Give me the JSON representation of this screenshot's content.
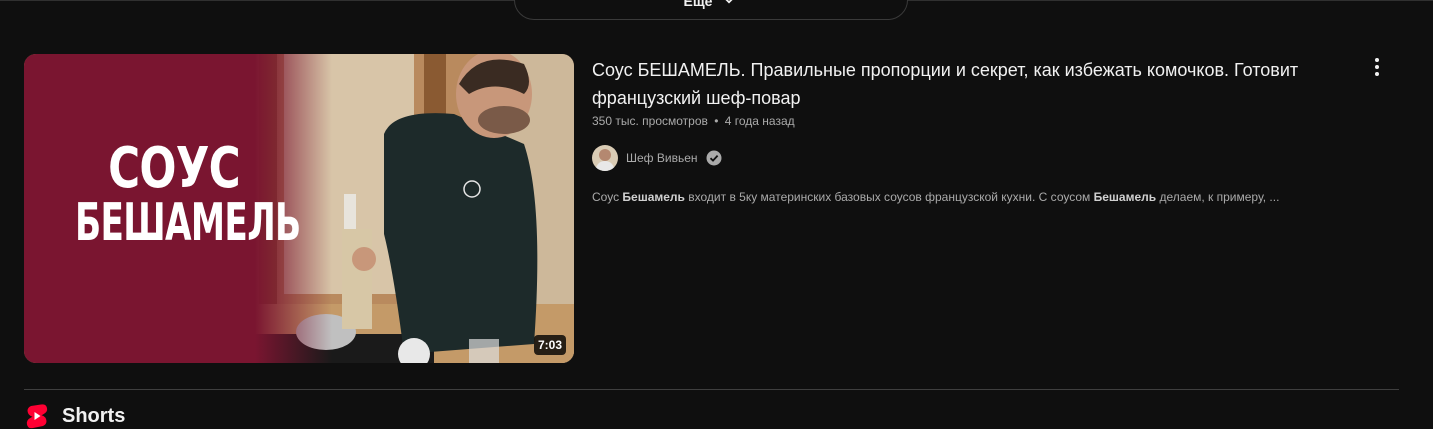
{
  "more_button": {
    "label": "Еще",
    "icon": "chevron-down-icon"
  },
  "video": {
    "thumbnail_text": {
      "line1": "СОУС",
      "line2": "БЕШАМЕЛЬ"
    },
    "duration": "7:03",
    "title": "Соус БЕШАМЕЛЬ. Правильные пропорции и секрет, как избежать комочков. Готовит французский шеф-повар",
    "views": "350 тыс. просмотров",
    "separator": "•",
    "age": "4 года назад",
    "channel": {
      "name": "Шеф Вивьен",
      "verified": true,
      "icon": "verified-check-icon"
    },
    "description": {
      "p1": "Соус ",
      "b1": "Бешамель",
      "p2": " входит в 5ку материнских базовых соусов французской кухни. С соусом ",
      "b2": "Бешамель",
      "p3": " делаем, к примеру, ..."
    },
    "menu_icon": "more-vert-icon"
  },
  "shelf": {
    "title": "Shorts",
    "icon": "shorts-logo-icon"
  },
  "colors": {
    "background": "#0f0f0f",
    "text_primary": "#f1f1f1",
    "text_secondary": "#aaaaaa",
    "shorts_red": "#ff0033",
    "thumb_burgundy": "#7a1530"
  }
}
